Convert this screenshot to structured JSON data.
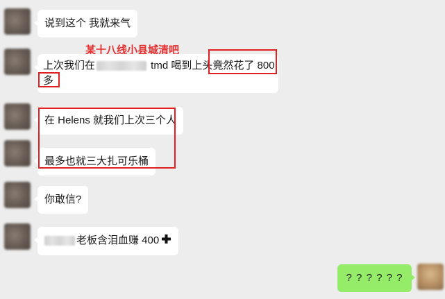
{
  "messages": [
    {
      "text": "说到这个 我就来气"
    },
    {
      "line1_pre": "上次我们在",
      "line1_post": " tmd 喝到上头竟然花了 800",
      "line2": "多"
    },
    {
      "text": "在 Helens 就我们上次三个人"
    },
    {
      "text": "最多也就三大扎可乐桶"
    },
    {
      "text": "你敢信?"
    },
    {
      "text": "老板含泪血赚 400"
    }
  ],
  "self_message": {
    "text": "? ? ? ? ? ?"
  },
  "annotation": {
    "text": "某十八线小县城清吧",
    "color": "#e53030"
  },
  "icons": {
    "plus": "plus-icon"
  },
  "colors": {
    "background": "#ededed",
    "bubble": "#ffffff",
    "self_bubble": "#95ec69",
    "highlight": "#e02020"
  }
}
